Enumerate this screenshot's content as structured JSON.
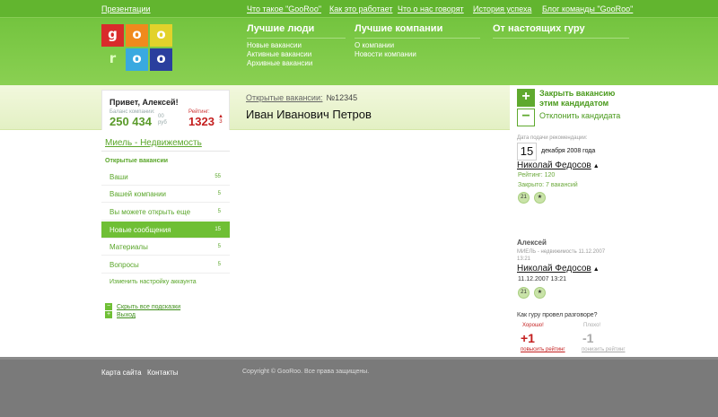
{
  "top_links": [
    "Презентации",
    "Что такое \"GooRoo\"",
    "Как это работает",
    "Что о нас говорят",
    "История успеха",
    "Блог команды \"GooRoo\""
  ],
  "logo": {
    "letters": [
      "g",
      "o",
      "o",
      "r",
      "o",
      "o"
    ],
    "colors": [
      "#d92b2b",
      "#f08a1d",
      "#e2d22b",
      "#9ad14b",
      "#39a9e0",
      "#2a3f9e"
    ]
  },
  "nav": {
    "people": {
      "title": "Лучшие люди",
      "items": [
        "Новые вакансии",
        "Активные вакансии",
        "Архивные вакансии"
      ]
    },
    "companies": {
      "title": "Лучшие компании",
      "items": [
        "О компании",
        "Новости компании"
      ]
    },
    "gurus": {
      "title": "От настоящих гуру"
    }
  },
  "greeting": {
    "hello": "Привет, Алексей!",
    "balance_label": "Баланс компании:",
    "balance": "250 434",
    "currency_1": "00",
    "currency_2": "руб",
    "rating_label": "Рейтинг:",
    "rating": "1323",
    "rating_delta": "3"
  },
  "vacancy": {
    "label": "Открытые вакансии:",
    "number": "№12345"
  },
  "person_name": "Иван Иванович Петров",
  "actions": {
    "close": {
      "symbol": "+",
      "line1": "Закрыть вакансию",
      "line2": "этим кандидатом"
    },
    "reject": {
      "symbol": "−",
      "label": "Отклонить кандидата"
    }
  },
  "sidebar": {
    "company": "Миель - Недвижемость",
    "section": "Открытые вакансии",
    "items": [
      {
        "label": "Ваши",
        "count": "55"
      },
      {
        "label": "Вашей компании",
        "count": "5"
      },
      {
        "label": "Вы можете открыть еще",
        "count": "5"
      },
      {
        "label": "Новые сообщения",
        "count": "15",
        "active": true
      },
      {
        "label": "Материалы",
        "count": "5"
      },
      {
        "label": "Вопросы",
        "count": "5"
      }
    ],
    "settings": "Изменить настройку аккаунта",
    "hide_hints": "Скрыть все подсказки",
    "exit": "Выход"
  },
  "recommendation": {
    "date_label": "Дата подачи рекомендации:",
    "day": "15",
    "month_year": "декабря 2008 года",
    "candidate": "Николай Федосов",
    "rating": "Рейтинг: 120",
    "closed": "Закрыто: 7 вакансий",
    "badge_count": "21",
    "badge_star": "★"
  },
  "message": {
    "author": "Алексей",
    "org_line1": "МИЕЛЬ - недвижимость 11.12.2007",
    "org_line2": "13:21",
    "candidate": "Николай Федосов",
    "datetime": "11.12.2007 13:21",
    "badge_count": "21",
    "badge_star": "★"
  },
  "feedback": {
    "question": "Как гуру провел разговоре?",
    "good": "Хорошо!",
    "bad": "Плохо!",
    "plus": "+1",
    "minus": "-1",
    "raise": "повысить рейтинг",
    "lower": "понизить рейтинг"
  },
  "footer": {
    "sitemap": "Карта сайта",
    "contacts": "Контакты",
    "copyright": "Copyright © GooRoo. Все права защищены."
  }
}
